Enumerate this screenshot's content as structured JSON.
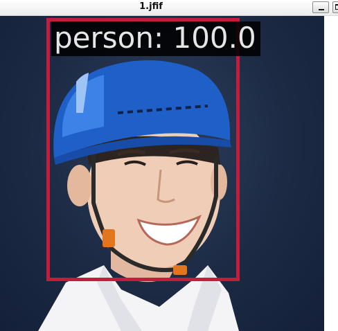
{
  "window": {
    "title": "1.jfif",
    "buttons": [
      "minimize",
      "maximize"
    ]
  },
  "detection": {
    "label": "person: 100.0",
    "box_color": "#c21d3c"
  },
  "image": {
    "subject": "person-wearing-blue-hard-hat",
    "background_color": "#1c2a44",
    "helmet_color": "#1f5fc8"
  }
}
